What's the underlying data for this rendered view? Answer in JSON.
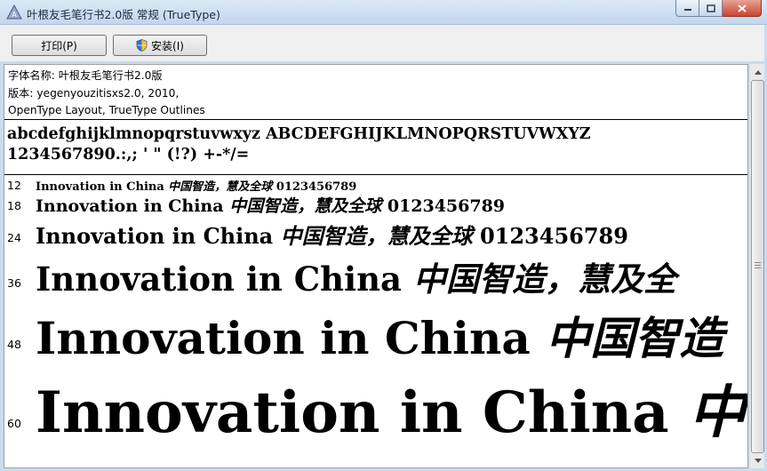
{
  "window": {
    "title": "叶根友毛笔行书2.0版 常规 (TrueType)",
    "controls": {
      "minimize_icon": "minimize-icon",
      "maximize_icon": "maximize-icon",
      "close_icon": "close-icon"
    }
  },
  "toolbar": {
    "print_label": "打印(P)",
    "install_label": "安装(I)"
  },
  "info": {
    "font_name": "字体名称: 叶根友毛笔行书2.0版",
    "version": "版本: yegenyouzitisxs2.0, 2010,",
    "tech": "OpenType Layout, TrueType Outlines"
  },
  "charset": {
    "line1": "abcdefghijklmnopqrstuvwxyz ABCDEFGHIJKLMNOPQRSTUVWXYZ",
    "line2": "1234567890.:,; ' \" (!?) +-*/="
  },
  "samples": [
    {
      "size": "12",
      "latin": "Innovation in China ",
      "cjk": "中国智造，慧及全球",
      "digits": " 0123456789"
    },
    {
      "size": "18",
      "latin": "Innovation in China ",
      "cjk": "中国智造，慧及全球",
      "digits": " 0123456789"
    },
    {
      "size": "24",
      "latin": "Innovation in China ",
      "cjk": "中国智造，慧及全球",
      "digits": " 0123456789"
    },
    {
      "size": "36",
      "latin": "Innovation in China ",
      "cjk": "中国智造，慧及全",
      "digits": ""
    },
    {
      "size": "48",
      "latin": "Innovation in China ",
      "cjk": "中国智造",
      "digits": ""
    },
    {
      "size": "60",
      "latin": "Innovation in China ",
      "cjk": "中国",
      "digits": ""
    }
  ],
  "colors": {
    "titlebar": "#c9dcef",
    "content_bg": "#ffffff",
    "close_button": "#c8452f"
  }
}
